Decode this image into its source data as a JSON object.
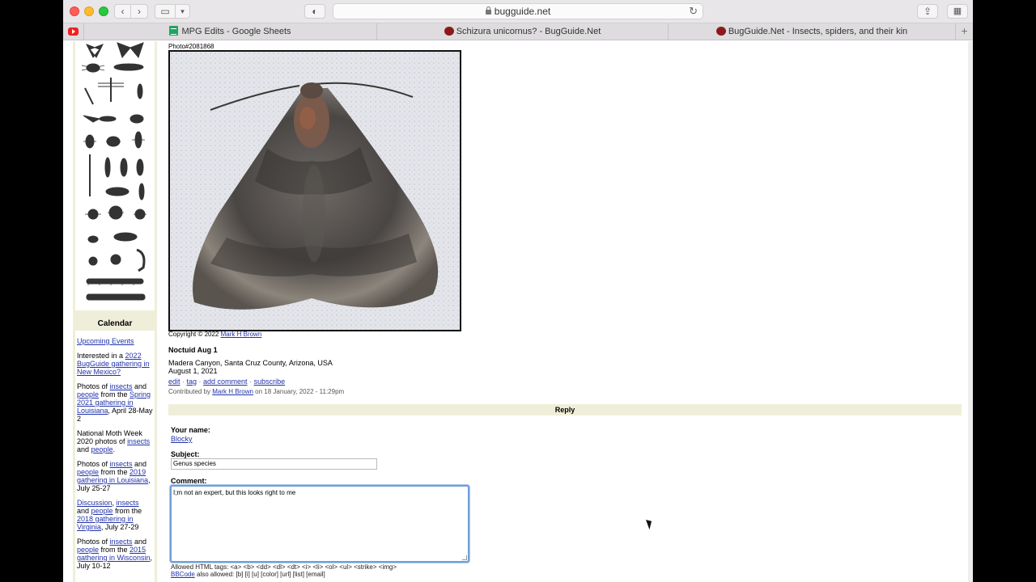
{
  "browser": {
    "url": "bugguide.net",
    "tabs": [
      {
        "label": "MPG Edits - Google Sheets",
        "icon": "sheets-icon"
      },
      {
        "label": "Schizura unicornus? - BugGuide.Net",
        "icon": "bugguide-icon"
      },
      {
        "label": "BugGuide.Net - Insects, spiders, and their kin",
        "icon": "bugguide-icon"
      }
    ],
    "accent": "#6fa0d8"
  },
  "calendar": {
    "title": "Calendar",
    "upcoming": "Upcoming Events",
    "b2_pre": "Interested in a ",
    "b2_link": "2022 BugGuide gathering in New Mexico?",
    "b3_pre": "Photos of ",
    "b3_l1": "insects",
    "b3_mid": " and ",
    "b3_l2": "people",
    "b3_mid2": " from the ",
    "b3_l3": "Spring 2021 gathering in Louisiana",
    "b3_post": ", April 28-May 2",
    "b4_pre": "National Moth Week 2020 photos of ",
    "b4_l1": "insects",
    "b4_mid": " and ",
    "b4_l2": "people",
    "b4_post": ".",
    "b5_pre": "Photos of ",
    "b5_l1": "insects",
    "b5_mid": " and ",
    "b5_l2": "people",
    "b5_mid2": " from the ",
    "b5_l3": "2019 gathering in Louisiana",
    "b5_post": ", July 25-27",
    "b6_l1": "Discussion",
    "b6_mid": ", ",
    "b6_l2": "insects",
    "b6_mid2": " and ",
    "b6_l3": "people",
    "b6_mid3": " from the ",
    "b6_l4": "2018 gathering in Virginia",
    "b6_post": ", July 27-29",
    "b7_pre": "Photos of ",
    "b7_l1": "insects",
    "b7_mid": " and ",
    "b7_l2": "people",
    "b7_mid2": " from the ",
    "b7_l3": "2015 gathering in Wisconsin",
    "b7_post": ", July 10-12"
  },
  "photo": {
    "id_label": "Photo#2081868",
    "copyright_pre": "Copyright © 2022 ",
    "copyright_author": "Mark H Brown",
    "title": "Noctuid Aug 1",
    "location": "Madera Canyon, Santa Cruz County, Arizona, USA",
    "date": "August 1, 2021",
    "actions": [
      "edit",
      "tag",
      "add comment",
      "subscribe"
    ],
    "contrib_pre": "Contributed by ",
    "contrib_author": "Mark H Brown",
    "contrib_post": " on 18 January, 2022 - 11:29pm"
  },
  "reply": {
    "header": "Reply",
    "name_label": "Your name:",
    "name_value": "Blocky",
    "subject_label": "Subject:",
    "subject_value": "Genus species",
    "comment_label": "Comment:",
    "comment_value": "I;m not an expert, but this looks right to me",
    "allowed_html": "Allowed HTML tags: <a> <b> <dd> <dl> <dt> <i> <li> <ol> <ul> <strike> <img>",
    "bbcode_link": "BBCode",
    "bbcode_post": " also allowed: [b] [i] [u] [color] [url] [list] [email]"
  }
}
